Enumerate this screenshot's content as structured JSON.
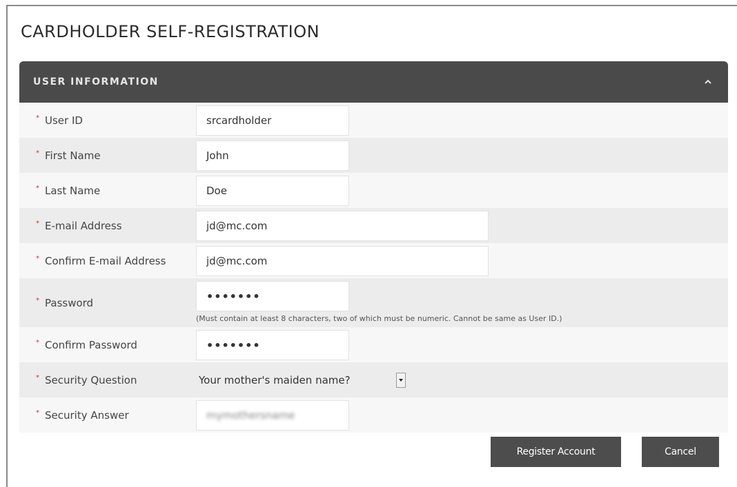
{
  "page": {
    "title": "CARDHOLDER SELF-REGISTRATION"
  },
  "section": {
    "title": "USER INFORMATION",
    "collapse_icon": "chevron-up-icon"
  },
  "required_marker": "*",
  "fields": {
    "user_id": {
      "label": "User ID",
      "value": "srcardholder"
    },
    "first_name": {
      "label": "First Name",
      "value": "John"
    },
    "last_name": {
      "label": "Last Name",
      "value": "Doe"
    },
    "email": {
      "label": "E-mail Address",
      "value": "jd@mc.com"
    },
    "confirm_email": {
      "label": "Confirm E-mail Address",
      "value": "jd@mc.com"
    },
    "password": {
      "label": "Password",
      "value": "•••••••",
      "hint": "(Must contain at least 8 characters, two of which must be numeric. Cannot be same as User ID.)"
    },
    "confirm_password": {
      "label": "Confirm Password",
      "value": "•••••••"
    },
    "security_question": {
      "label": "Security Question",
      "value": "Your mother's maiden name?"
    },
    "security_answer": {
      "label": "Security Answer",
      "value": "mymothersname"
    }
  },
  "buttons": {
    "register": "Register Account",
    "cancel": "Cancel"
  },
  "colors": {
    "header_bg": "#4a4a4a",
    "required": "#d0342c",
    "button_bg": "#4d4d4d"
  }
}
